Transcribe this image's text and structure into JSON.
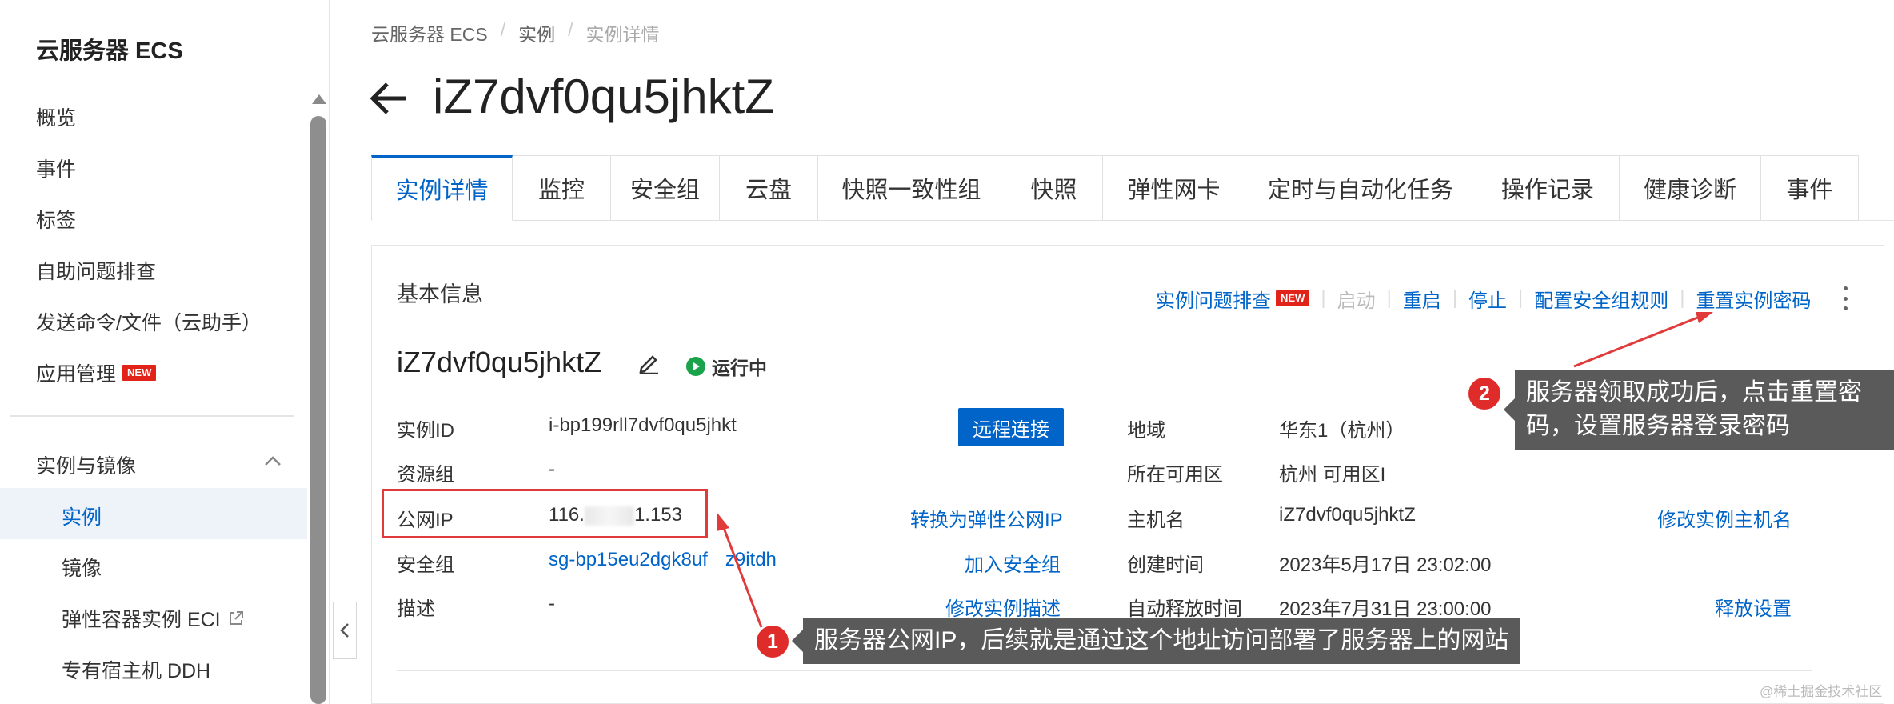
{
  "sidebar": {
    "title": "云服务器 ECS",
    "items": [
      {
        "label": "概览"
      },
      {
        "label": "事件"
      },
      {
        "label": "标签"
      },
      {
        "label": "自助问题排查"
      },
      {
        "label": "发送命令/文件（云助手）"
      },
      {
        "label": "应用管理",
        "badge": "NEW"
      }
    ],
    "group": {
      "label": "实例与镜像",
      "expanded": true
    },
    "sub_items": [
      {
        "label": "实例",
        "active": true
      },
      {
        "label": "镜像"
      },
      {
        "label": "弹性容器实例 ECI"
      },
      {
        "label": "专有宿主机 DDH"
      }
    ]
  },
  "breadcrumb": [
    "云服务器 ECS",
    "实例",
    "实例详情"
  ],
  "page_title": "iZ7dvf0qu5jhktZ",
  "tabs": [
    "实例详情",
    "监控",
    "安全组",
    "云盘",
    "快照一致性组",
    "快照",
    "弹性网卡",
    "定时与自动化任务",
    "操作记录",
    "健康诊断",
    "事件"
  ],
  "active_tab": "实例详情",
  "card": {
    "heading": "基本信息",
    "actions": [
      {
        "label": "实例问题排查",
        "badge": "NEW"
      },
      {
        "label": "启动",
        "disabled": true
      },
      {
        "label": "重启"
      },
      {
        "label": "停止"
      },
      {
        "label": "配置安全组规则"
      },
      {
        "label": "重置实例密码"
      }
    ],
    "instance_name": "iZ7dvf0qu5jhktZ",
    "status": "运行中",
    "remote_button": "远程连接",
    "left": {
      "instance_id_label": "实例ID",
      "instance_id": "i-bp199rll7dvf0qu5jhkt",
      "resource_group_label": "资源组",
      "resource_group": "-",
      "public_ip_label": "公网IP",
      "public_ip_prefix": "116.",
      "public_ip_suffix": "1.153",
      "security_group_label": "安全组",
      "security_group": "sg-bp15eu2dgk8uf",
      "security_group_tail": "z9itdh",
      "desc_label": "描述",
      "desc": "-"
    },
    "left_links": {
      "convert_eip": "转换为弹性公网IP",
      "join_sg": "加入安全组",
      "edit_desc": "修改实例描述"
    },
    "right": {
      "region_label": "地域",
      "region": "华东1（杭州）",
      "zone_label": "所在可用区",
      "zone": "杭州 可用区I",
      "hostname_label": "主机名",
      "hostname": "iZ7dvf0qu5jhktZ",
      "created_label": "创建时间",
      "created": "2023年5月17日 23:02:00",
      "release_label": "自动释放时间",
      "release": "2023年7月31日 23:00:00"
    },
    "right_links": {
      "edit_hostname": "修改实例主机名",
      "release_settings": "释放设置"
    }
  },
  "annotations": [
    {
      "number": "1",
      "text": "服务器公网IP，后续就是通过这个地址访问部署了服务器上的网站"
    },
    {
      "number": "2",
      "line1": "服务器领取成功后，点击重置密",
      "line2": "码，设置服务器登录密码"
    }
  ],
  "watermark": "@稀土掘金技术社区",
  "colors": {
    "accent": "#0064c8",
    "annotation_red": "#e02b2b",
    "callout_bg": "#5a5a5a",
    "status_green": "#1aa34a"
  }
}
